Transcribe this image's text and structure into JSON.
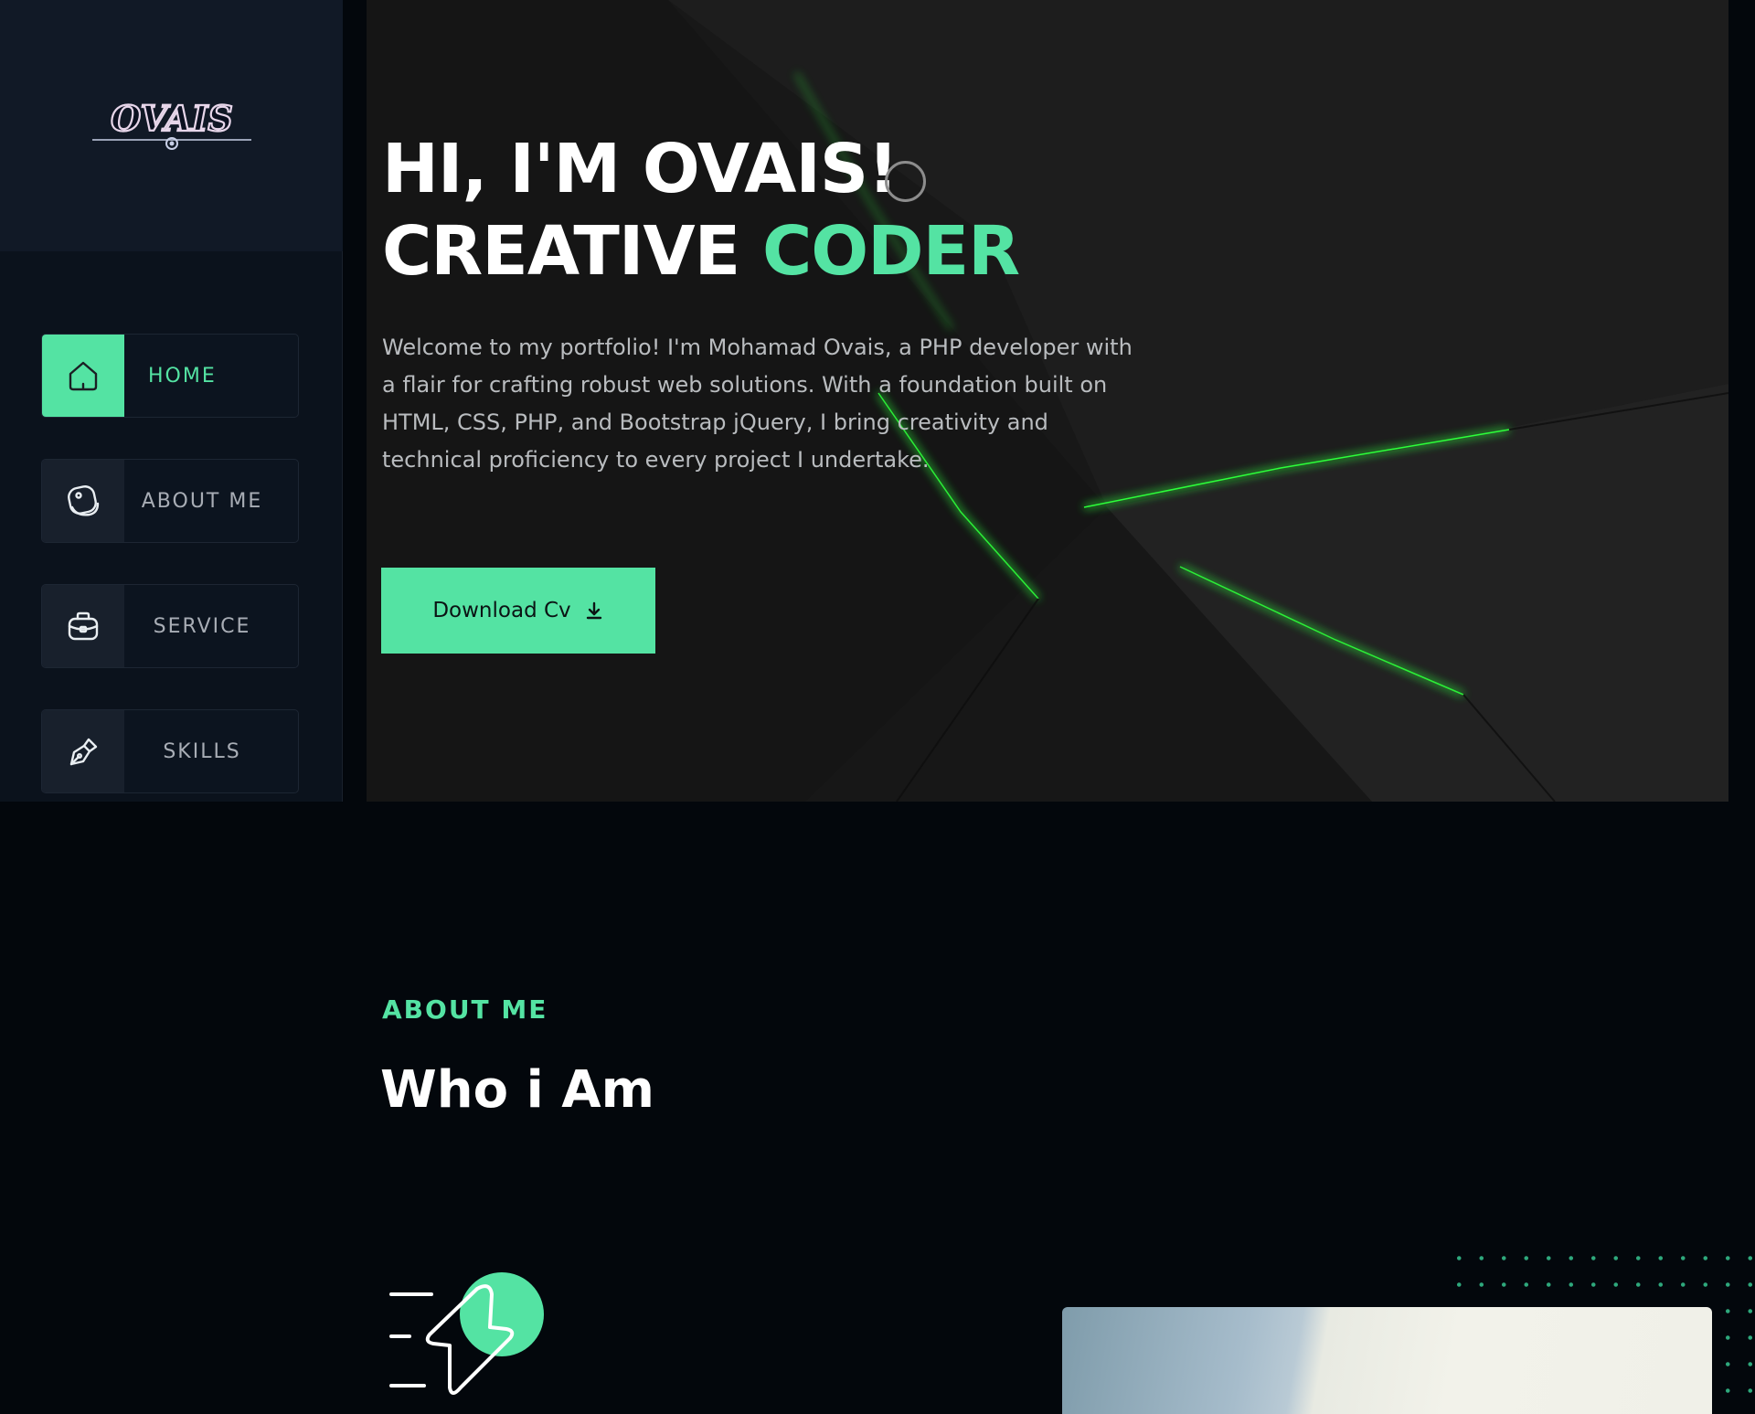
{
  "sidebar": {
    "logo_text": "OVAIS",
    "nav": [
      {
        "label": "HOME",
        "icon": "home-icon",
        "active": true
      },
      {
        "label": "ABOUT ME",
        "icon": "user-icon",
        "active": false
      },
      {
        "label": "SERVICE",
        "icon": "briefcase-icon",
        "active": false
      },
      {
        "label": "SKILLS",
        "icon": "pen-tool-icon",
        "active": false
      }
    ]
  },
  "hero": {
    "title_line1": "HI, I'M OVAIS!",
    "title_line2_prefix": "CREATIVE",
    "title_line2_accent": "CODER",
    "description": "Welcome to my portfolio! I'm Mohamad Ovais, a PHP developer with a flair for crafting  robust web solutions. With a foundation built on HTML, CSS, PHP, and Bootstrap jQuery, I bring creativity and technical proficiency to every project I undertake.",
    "cta_label": "Download Cv",
    "cta_icon": "download-icon"
  },
  "about": {
    "kicker": "ABOUT ME",
    "title": "Who i Am"
  },
  "colors": {
    "accent": "#54e3a3",
    "background": "#03070c",
    "sidebar": "#0b121c"
  }
}
